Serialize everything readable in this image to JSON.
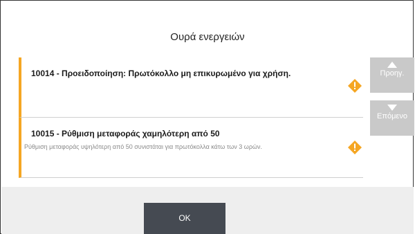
{
  "dialog": {
    "title": "Ουρά ενεργειών",
    "accent_color": "#f5a623",
    "nav_button_color": "#c9c9c9",
    "ok_button_color": "#454a52"
  },
  "items": [
    {
      "title": "10014 - Προειδοποίηση: Πρωτόκολλο μη επικυρωμένο για χρήση.",
      "description": "",
      "icon": "warning-icon"
    },
    {
      "title": "10015 - Ρύθμιση μεταφοράς χαμηλότερη από 50",
      "description": "Ρύθμιση μεταφοράς υψηλότερη από 50 συνιστάται για πρωτόκολλα κάτω των 3 ωρών.",
      "icon": "warning-icon"
    }
  ],
  "nav": {
    "prev_label": "Προηγ.",
    "next_label": "Επόμενο"
  },
  "footer": {
    "ok_label": "OK"
  }
}
